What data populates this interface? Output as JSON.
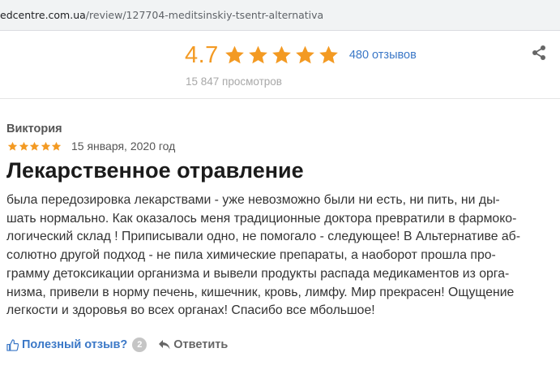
{
  "browser": {
    "url_host": "edcentre.com.ua",
    "url_path": "/review/127704-meditsinskiy-tsentr-alternativa"
  },
  "summary": {
    "rating_value": "4.7",
    "stars": 5,
    "reviews_count": "480 отзывов",
    "views": "15 847 просмотров"
  },
  "review": {
    "author": "Виктория",
    "stars": 5,
    "date": "15 января, 2020 год",
    "title": "Лекарственное отравление",
    "body_lines": [
      "была передозировка лекарствами - уже невозможно были ни есть, ни пить, ни ды-",
      "шать нормально. Как оказалось меня традиционные доктора превратили в фармоко-",
      "логический склад ! Приписывали одно, не помогало - следующее! В Альтернативе аб-",
      "солютно другой подход - не пила химические препараты, а наоборот прошла про-",
      "грамму детоксикации организма и вывели продукты распада медикаментов из орга-",
      "низма, привели в норму печень, кишечник, кровь, лимфу. Мир прекрасен! Ощущение",
      "легкости и здоровья во всех органах! Спасибо все мбольшое!"
    ]
  },
  "actions": {
    "helpful_label": "Полезный отзыв?",
    "helpful_count": "2",
    "reply_label": "Ответить"
  },
  "colors": {
    "star": "#f39a23",
    "link": "#3b78c7",
    "muted": "#a8a8a8"
  },
  "icons": {
    "share": "share-icon",
    "thumb": "thumbs-up-icon",
    "reply": "reply-arrow-icon",
    "star": "star-icon"
  }
}
